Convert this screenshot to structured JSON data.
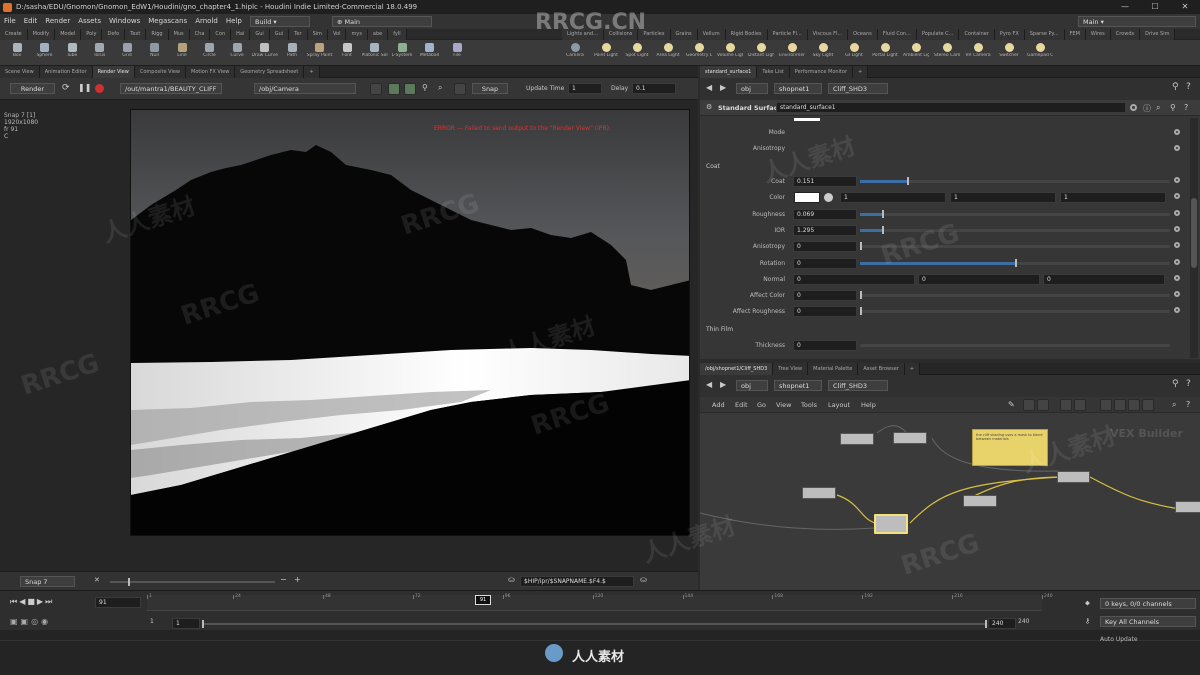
{
  "window": {
    "title": "D:/sasha/EDU/Gnomon/Gnomon_EdW1/Houdini/gno_chapter4_1.hiplc - Houdini Indie Limited-Commercial 18.0.499",
    "minimize": "—",
    "maximize": "☐",
    "close": "✕"
  },
  "menu": [
    "File",
    "Edit",
    "Render",
    "Assets",
    "Windows",
    "Megascans",
    "Arnold",
    "Help"
  ],
  "desktop_select": "Build",
  "main_select": "Main",
  "right_select": "Main",
  "shelf_tabs_left": [
    "Create",
    "Modify",
    "Model",
    "Poly",
    "Defo",
    "Text",
    "Rigg",
    "Mus",
    "Cha",
    "Con",
    "Hai",
    "Gui",
    "Gui",
    "Ter",
    "Sim",
    "Vol",
    "mys",
    "abe",
    "fyll"
  ],
  "shelf_tabs_right": [
    "Lights and...",
    "Collisions",
    "Particles",
    "Grains",
    "Vellum",
    "Rigid Bodies",
    "Particle Fl...",
    "Viscous Fl...",
    "Oceans",
    "Fluid Con...",
    "Populate C...",
    "Container",
    "Pyro FX",
    "Sparse Py...",
    "FEM",
    "Wires",
    "Crowds",
    "Drive Sim"
  ],
  "tools_left": [
    "Box",
    "Sphere",
    "Tube",
    "Torus",
    "Grid",
    "Null",
    "Line",
    "Circle",
    "Curve",
    "Draw Curve",
    "Path",
    "Spray Paint",
    "Font",
    "Platonic Solids",
    "L-System",
    "Metaball",
    "File"
  ],
  "tools_right": [
    "Camera",
    "Point Light",
    "Spot Light",
    "Area Light",
    "Geometry Light",
    "Volume Light",
    "Distant Light",
    "Environment Light",
    "Sky Light",
    "GI Light",
    "Portal Light",
    "Ambient Light",
    "Stereo Camera",
    "VR Camera",
    "Switcher",
    "Gamepad Camera"
  ],
  "left_pane_tabs": [
    "Scene View",
    "Animation Editor",
    "Render View",
    "Composite View",
    "Motion FX View",
    "Geometry Spreadsheet"
  ],
  "render_view": {
    "render_label": "Render",
    "rop_path": "/out/mantra1/BEAUTY_CLIFF",
    "camera": "/obj/Camera",
    "snap_btn": "Snap",
    "update_time_label": "Update Time",
    "update_time_value": "1",
    "delay_label": "Delay",
    "delay_value": "0.1",
    "snap_info": [
      "Snap 7 [1]",
      "1920x1080",
      "fr 91",
      "C"
    ],
    "error_text": "ERROR — Failed to send output to the \"Render View\" (IPR).",
    "snap_select": "Snap 7",
    "ship_path": "$HIP/ipr/$SNAPNAME.$F4.$"
  },
  "param_pane": {
    "tabs": [
      "standard_surface1",
      "Take List",
      "Performance Monitor"
    ],
    "path": [
      "obj",
      "shopnet1",
      "Cliff_SHD3"
    ],
    "node_type": "Standard Surface",
    "node_name": "standard_surface1",
    "top_rows": [
      "Mode",
      "Anisotropy"
    ],
    "section_coat": "Coat",
    "rows": [
      {
        "label": "Coat",
        "value": "0.151",
        "fill": 0.15
      },
      {
        "label": "Color",
        "value": "",
        "c1": "1",
        "c2": "1",
        "c3": "1"
      },
      {
        "label": "Roughness",
        "value": "0.069",
        "fill": 0.07
      },
      {
        "label": "IOR",
        "value": "1.295",
        "fill": 0.07
      },
      {
        "label": "Anisotropy",
        "value": "0",
        "fill": 0
      },
      {
        "label": "Rotation",
        "value": "0",
        "fill": 0.5
      },
      {
        "label": "Normal",
        "value": "0",
        "c2": "0",
        "c3": "0"
      },
      {
        "label": "Affect Color",
        "value": "0",
        "fill": 0
      },
      {
        "label": "Affect Roughness",
        "value": "0",
        "fill": 0
      }
    ],
    "section_thin": "Thin Film",
    "thin_rows": [
      {
        "label": "Thickness",
        "value": "0"
      }
    ]
  },
  "network": {
    "tabs": [
      "/obj/shopnet1/Cliff_SHD3",
      "Tree View",
      "Material Palette",
      "Asset Browser"
    ],
    "path": [
      "obj",
      "shopnet1",
      "Cliff_SHD3"
    ],
    "menu": [
      "Add",
      "Edit",
      "Go",
      "View",
      "Tools",
      "Layout",
      "Help"
    ],
    "context_label": "VEX Builder",
    "sticky_note": "the cliff shading uses a mask to blend between materials"
  },
  "timeline": {
    "frame": "91",
    "current_marker": "91",
    "ticks": [
      "1",
      "24",
      "48",
      "72",
      "96",
      "120",
      "144",
      "168",
      "192",
      "216",
      "240"
    ],
    "start": "1",
    "start2": "1",
    "end": "240",
    "end2": "240",
    "keys_info": "0 keys, 0/0 channels",
    "key_all": "Key All Channels",
    "auto_update": "Auto Update"
  },
  "watermarks": [
    "RRCG.CN",
    "RRCG",
    "人人素材"
  ],
  "footer_logo": "人人素材",
  "colors": {
    "accent": "#3a6ea5",
    "error": "#e03030",
    "sticky": "#e8d36a",
    "selected": "#f2e07a",
    "wire": "#d9c040"
  }
}
